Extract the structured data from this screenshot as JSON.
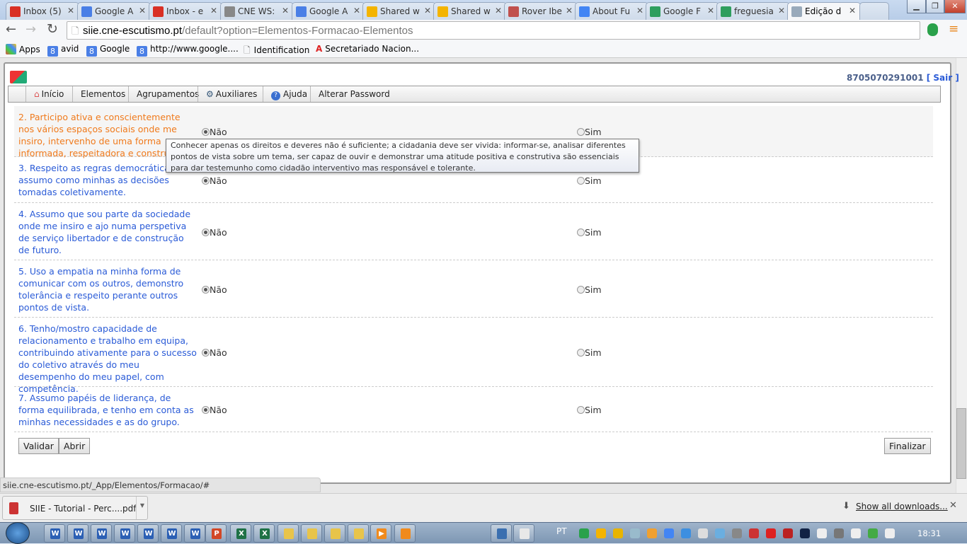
{
  "browser": {
    "tabs": [
      {
        "label": "Inbox (5)",
        "icon": "gmail-icon",
        "color": "#d93025"
      },
      {
        "label": "Google A",
        "icon": "calendar-icon",
        "color": "#4a7fe6"
      },
      {
        "label": "Inbox - e",
        "icon": "gmail-icon",
        "color": "#d93025"
      },
      {
        "label": "CNE WS:",
        "icon": "user-icon",
        "color": "#888888"
      },
      {
        "label": "Google A",
        "icon": "calendar-icon",
        "color": "#4a7fe6"
      },
      {
        "label": "Shared w",
        "icon": "drive-icon",
        "color": "#f4b400"
      },
      {
        "label": "Shared w",
        "icon": "drive-icon",
        "color": "#f4b400"
      },
      {
        "label": "Rover Ibe",
        "icon": "rover-icon",
        "color": "#c0504d"
      },
      {
        "label": "About Fu",
        "icon": "google-icon",
        "color": "#4285f4"
      },
      {
        "label": "Google F",
        "icon": "chart-icon",
        "color": "#2e9e5e"
      },
      {
        "label": "freguesia",
        "icon": "chart-icon",
        "color": "#2e9e5e"
      },
      {
        "label": "Edição d",
        "icon": "document-icon",
        "color": "#9ab"
      }
    ],
    "url_host": "siie.cne-escutismo.pt",
    "url_path": "/default?option=Elementos-Formacao-Elementos",
    "bookmarks": [
      {
        "label": "Apps",
        "icon": "apps-icon"
      },
      {
        "label": "avid",
        "icon": "google-icon"
      },
      {
        "label": "Google",
        "icon": "google-icon"
      },
      {
        "label": "http://www.google....",
        "icon": "google-icon"
      },
      {
        "label": "Identification",
        "icon": "page-icon"
      },
      {
        "label": "Secretariado Nacion...",
        "icon": "site-icon"
      }
    ]
  },
  "app": {
    "user_id": "8705070291001",
    "logout": "[ Sair ]",
    "menu": [
      "Início",
      "Elementos",
      "Agrupamentos",
      "Auxiliares",
      "Ajuda",
      "Alterar Password"
    ],
    "questions": [
      {
        "text": "2. Participo ativa e conscientemente nos vários espaços sociais onde me insiro, intervenho de uma forma informada, respeitadora e construtiva.",
        "selected": "Não",
        "highlighted": true
      },
      {
        "text": "3. Respeito as regras democráticas e assumo como minhas as decisões tomadas coletivamente.",
        "selected": "Não"
      },
      {
        "text": "4. Assumo que sou parte da sociedade onde me insiro e ajo numa perspetiva de serviço libertador e de construção de futuro.",
        "selected": "Não"
      },
      {
        "text": "5. Uso a empatia na minha forma de comunicar com os outros, demonstro tolerância e respeito perante outros pontos de vista.",
        "selected": "Não"
      },
      {
        "text": "6. Tenho/mostro capacidade de relacionamento e trabalho em equipa, contribuindo ativamente para o sucesso do coletivo através do meu desempenho do meu papel, com competência.",
        "selected": "Não"
      },
      {
        "text": "7. Assumo papéis de liderança, de forma equilibrada, e tenho em conta as minhas necessidades e as do grupo.",
        "selected": "Não"
      }
    ],
    "option_no": "Não",
    "option_yes": "Sim",
    "tooltip": "Conhecer apenas os direitos e deveres não é suficiente; a cidadania deve ser vivida: informar-se, analisar diferentes pontos de vista sobre um tema, ser capaz de ouvir e demonstrar uma atitude positiva e construtiva são essenciais para dar testemunho como cidadão interventivo mas responsável e tolerante.",
    "buttons": {
      "validate": "Validar",
      "open": "Abrir",
      "finish": "Finalizar"
    }
  },
  "status_url": "siie.cne-escutismo.pt/_App/Elementos/Formacao/#",
  "downloads": {
    "file": "SIIE - Tutorial - Perc....pdf",
    "show_all": "Show all downloads..."
  },
  "taskbar": {
    "language": "PT",
    "clock": "18:31"
  }
}
